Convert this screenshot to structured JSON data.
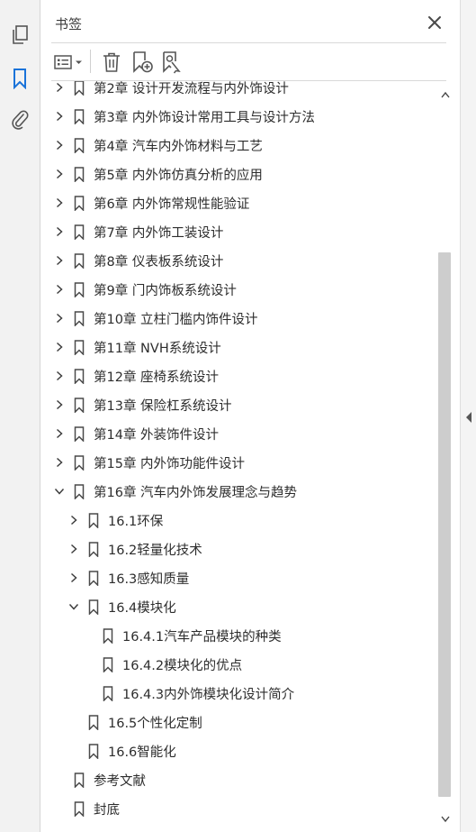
{
  "panel": {
    "title": "书签"
  },
  "bookmarks": [
    {
      "label": "第2章  设计开发流程与内外饰设计",
      "level": 0,
      "state": "collapsed",
      "bookmark": true
    },
    {
      "label": "第3章  内外饰设计常用工具与设计方法",
      "level": 0,
      "state": "collapsed",
      "bookmark": true
    },
    {
      "label": "第4章  汽车内外饰材料与工艺",
      "level": 0,
      "state": "collapsed",
      "bookmark": true
    },
    {
      "label": "第5章  内外饰仿真分析的应用",
      "level": 0,
      "state": "collapsed",
      "bookmark": true
    },
    {
      "label": "第6章  内外饰常规性能验证",
      "level": 0,
      "state": "collapsed",
      "bookmark": true
    },
    {
      "label": "第7章  内外饰工装设计",
      "level": 0,
      "state": "collapsed",
      "bookmark": true
    },
    {
      "label": "第8章  仪表板系统设计",
      "level": 0,
      "state": "collapsed",
      "bookmark": true
    },
    {
      "label": "第9章  门内饰板系统设计",
      "level": 0,
      "state": "collapsed",
      "bookmark": true
    },
    {
      "label": "第10章  立柱门槛内饰件设计",
      "level": 0,
      "state": "collapsed",
      "bookmark": true
    },
    {
      "label": "第11章  NVH系统设计",
      "level": 0,
      "state": "collapsed",
      "bookmark": true
    },
    {
      "label": "第12章  座椅系统设计",
      "level": 0,
      "state": "collapsed",
      "bookmark": true
    },
    {
      "label": "第13章  保险杠系统设计",
      "level": 0,
      "state": "collapsed",
      "bookmark": true
    },
    {
      "label": "第14章  外装饰件设计",
      "level": 0,
      "state": "collapsed",
      "bookmark": true
    },
    {
      "label": "第15章  内外饰功能件设计",
      "level": 0,
      "state": "collapsed",
      "bookmark": true
    },
    {
      "label": "第16章  汽车内外饰发展理念与趋势",
      "level": 0,
      "state": "expanded",
      "bookmark": true
    },
    {
      "label": "16.1环保",
      "level": 1,
      "state": "collapsed",
      "bookmark": true
    },
    {
      "label": "16.2轻量化技术",
      "level": 1,
      "state": "collapsed",
      "bookmark": true
    },
    {
      "label": "16.3感知质量",
      "level": 1,
      "state": "collapsed",
      "bookmark": true
    },
    {
      "label": "16.4模块化",
      "level": 1,
      "state": "expanded",
      "bookmark": true
    },
    {
      "label": "16.4.1汽车产品模块的种类",
      "level": 2,
      "state": "leaf",
      "bookmark": true
    },
    {
      "label": "16.4.2模块化的优点",
      "level": 2,
      "state": "leaf",
      "bookmark": true
    },
    {
      "label": "16.4.3内外饰模块化设计简介",
      "level": 2,
      "state": "leaf",
      "bookmark": true
    },
    {
      "label": "16.5个性化定制",
      "level": 1,
      "state": "leaf",
      "bookmark": true
    },
    {
      "label": "16.6智能化",
      "level": 1,
      "state": "leaf",
      "bookmark": true
    },
    {
      "label": "参考文献",
      "level": 0,
      "state": "leaf",
      "bookmark": true
    },
    {
      "label": "封底",
      "level": 0,
      "state": "leaf",
      "bookmark": true
    }
  ],
  "colors": {
    "accent": "#1a73d9",
    "icon": "#555555",
    "scroll_thumb": "#cdcdcd"
  },
  "icons": {
    "rail": [
      "pages-icon",
      "bookmark-icon",
      "attachment-icon"
    ],
    "toolbar": [
      "options-menu-icon",
      "delete-icon",
      "add-bookmark-icon",
      "bookmark-search-icon"
    ]
  }
}
